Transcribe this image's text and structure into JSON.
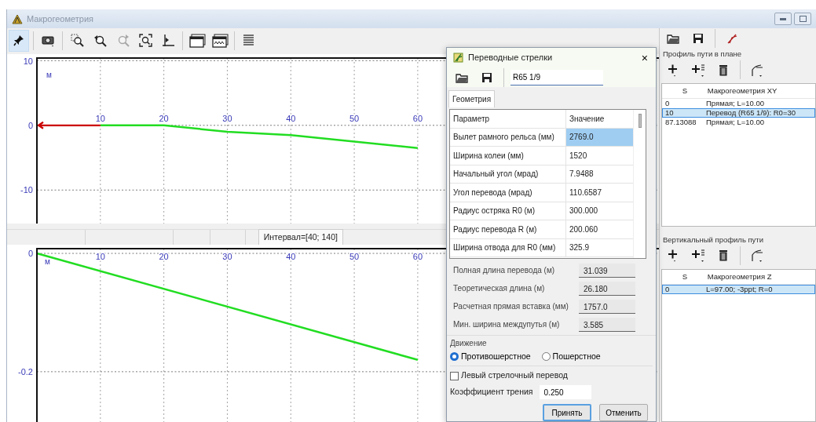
{
  "window": {
    "title": "Макрогеометрия"
  },
  "toolbar": [
    {
      "selected": true,
      "disabled": false
    },
    {
      "selected": false,
      "disabled": false
    },
    {
      "selected": false,
      "disabled": false
    },
    {
      "selected": false,
      "disabled": false
    },
    {
      "selected": false,
      "disabled": true
    },
    {
      "selected": false,
      "disabled": false
    },
    {
      "selected": false,
      "disabled": false
    },
    {
      "selected": false,
      "disabled": false
    },
    {
      "selected": false,
      "disabled": false
    },
    {
      "selected": false,
      "disabled": false
    }
  ],
  "plan_chart": {
    "origin_arrow": true,
    "chart_data": {
      "type": "line",
      "ylabel": "м",
      "grid": true,
      "x": [
        10,
        20,
        30,
        40,
        50,
        60
      ],
      "xlim": [
        0,
        98
      ],
      "ylim": [
        -15.3,
        10.4
      ],
      "xticks": [
        10,
        20,
        30,
        40,
        50,
        60
      ],
      "yticks": [
        -10,
        0,
        10
      ],
      "series": [
        {
          "color": "#22dd22",
          "values": [
            0,
            0,
            -1,
            -1.5,
            -2.5,
            -3.5
          ]
        }
      ]
    }
  },
  "status_bar": {
    "interval": "Интервал=[40; 140]"
  },
  "profile_chart": {
    "chart_data": {
      "type": "line",
      "ylabel": "м",
      "grid": true,
      "x": [
        0,
        60
      ],
      "xlim": [
        0,
        98
      ],
      "ylim": [
        -0.285,
        0.008
      ],
      "xticks": [
        10,
        20,
        30,
        40,
        50,
        60
      ],
      "yticks": [
        -0.2,
        0
      ],
      "series": [
        {
          "color": "#22dd22",
          "values": [
            0,
            -0.18
          ]
        }
      ]
    }
  },
  "dialog": {
    "title": "Переводные стрелки",
    "close": "×",
    "preset_field": {
      "value": "R65 1/9"
    },
    "tabs": [
      {
        "label": "Геометрия",
        "selected": true
      }
    ],
    "parameters": {
      "columns": [
        "Параметр",
        "Значение"
      ],
      "rows": [
        {
          "name": "Вылет рамного рельса (мм)",
          "value": "2769.0",
          "selected": true
        },
        {
          "name": "Ширина колеи (мм)",
          "value": "1520",
          "selected": false
        },
        {
          "name": "Начальный угол (мрад)",
          "value": "7.9488",
          "selected": false
        },
        {
          "name": "Угол перевода (мрад)",
          "value": "110.6587",
          "selected": false
        },
        {
          "name": "Радиус остряка R0 (м)",
          "value": "300.000",
          "selected": false
        },
        {
          "name": "Радиус перевода R (м)",
          "value": "200.060",
          "selected": false
        },
        {
          "name": "Ширина отвода для R0 (мм)",
          "value": "325.9",
          "selected": false
        }
      ]
    },
    "results": [
      {
        "label": "Полная длина перевода (м)",
        "value": "31.039"
      },
      {
        "label": "Теоретическая длина (м)",
        "value": "26.180"
      },
      {
        "label": "Расчетная прямая вставка (мм)",
        "value": "1757.0"
      },
      {
        "label": "Мин. ширина междупутья (м)",
        "value": "3.585"
      }
    ],
    "movement": {
      "label": "Движение",
      "options": [
        {
          "label": "Противошерстное",
          "selected": true
        },
        {
          "label": "Пошерстное",
          "selected": false
        }
      ]
    },
    "left_turnout": {
      "label": "Левый стрелочный перевод",
      "checked": false
    },
    "friction": {
      "label": "Коэффициент трения",
      "value": "0.250"
    },
    "buttons": [
      {
        "label": "Принять",
        "default": true
      },
      {
        "label": "Отменить",
        "default": false
      }
    ]
  },
  "plan_profile": {
    "title": "Профиль пути в плане",
    "columns": [
      "S",
      "Макрогеометрия XY"
    ],
    "rows": [
      {
        "s": "0",
        "text": "Прямая; L=10.00",
        "selected": false
      },
      {
        "s": "10",
        "text": "Перевод (R65 1/9): R0=30",
        "selected": true
      },
      {
        "s": "87.13088",
        "text": "Прямая; L=10.00",
        "selected": false
      }
    ]
  },
  "vertical_profile": {
    "title": "Вертикальный профиль пути",
    "columns": [
      "S",
      "Макрогеометрия Z"
    ],
    "rows": [
      {
        "s": "0",
        "text": "L=97.00; -3ppt; R=0",
        "selected": true
      }
    ]
  }
}
